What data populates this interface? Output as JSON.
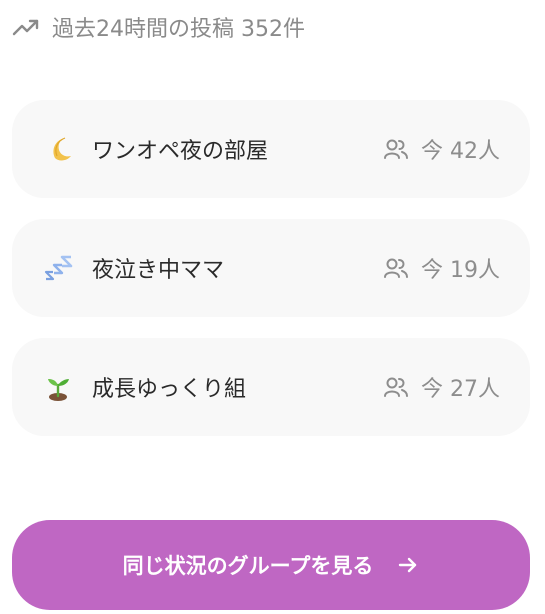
{
  "stats": {
    "icon": "trending-up-icon",
    "text": "過去24時間の投稿 352件"
  },
  "groups": [
    {
      "emoji": "crescent-moon-icon",
      "name": "ワンオペ夜の部屋",
      "members_icon": "people-icon",
      "count": "今 42人"
    },
    {
      "emoji": "zzz-sleep-icon",
      "name": "夜泣き中ママ",
      "members_icon": "people-icon",
      "count": "今 19人"
    },
    {
      "emoji": "seedling-icon",
      "name": "成長ゆっくり組",
      "members_icon": "people-icon",
      "count": "今 27人"
    }
  ],
  "cta": {
    "label": "同じ状況のグループを見る",
    "icon": "arrow-right-icon"
  },
  "colors": {
    "accent": "#bf67c3",
    "card_bg": "#f8f8f8",
    "muted_text": "#8a8a8a"
  }
}
